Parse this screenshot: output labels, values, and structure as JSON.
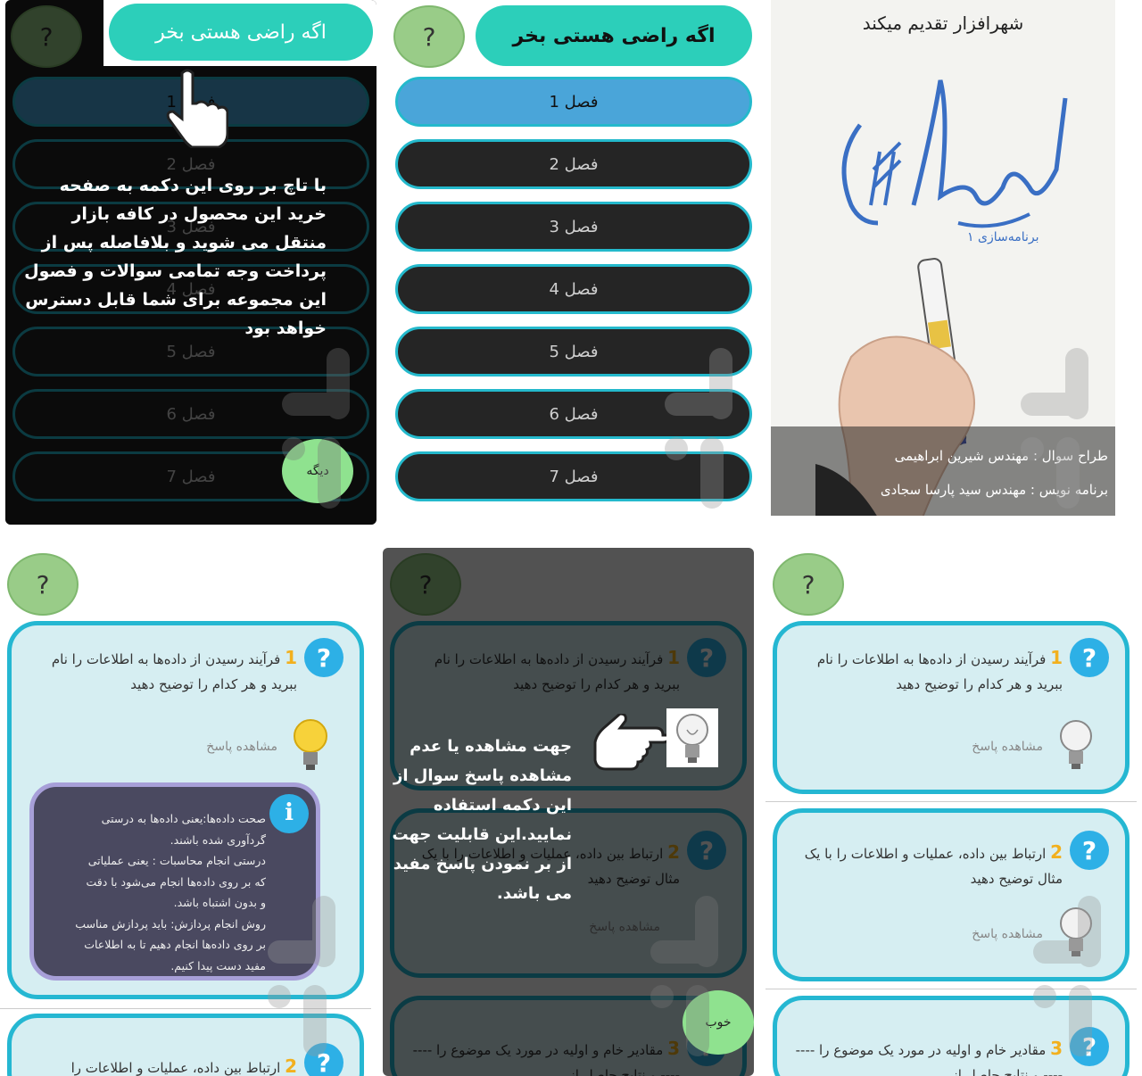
{
  "common": {
    "help_symbol": "?",
    "buy_label": "اگه راضی هستی بخر",
    "chapters": [
      "فصل 1",
      "فصل 2",
      "فصل 3",
      "فصل 4",
      "فصل 5",
      "فصل 6",
      "فصل 7"
    ],
    "see_answer": "مشاهده پاسخ"
  },
  "tutorial_buy": {
    "text": "با تاچ بر روی این دکمه به صفحه خرید این محصول در کافه بازار منتقل می شوید و بلافاصله پس از پرداخت وجه تمامی سوالات و فصول این مجموعه برای شما قابل دسترس خواهد بود",
    "next_label": "دیگه"
  },
  "splash": {
    "presents": "شهرافزار تقدیم میکند",
    "logo_text": "برنامه‌سازی ۱",
    "designer": "طراح سوال : مهندس شیرین ابراهیمی",
    "programmer": "برنامه نویس : مهندس سید پارسا سجادی"
  },
  "questions": [
    {
      "num": "1",
      "text": "فرآیند رسیدن از داده‌ها به اطلاعات را نام ببرید و هر کدام را توضیح دهید"
    },
    {
      "num": "2",
      "text": "ارتباط بین داده، عملیات و اطلاعات را با یک مثال توضیح دهید"
    },
    {
      "num": "3",
      "text": "مقادیر خام و اولیه در مورد یک موضوع را -------- و نتایج حاصل از"
    }
  ],
  "question_peek_panel4": "ارتباط بین داده، عملیات و اطلاعات را",
  "answer": {
    "info_symbol": "i",
    "lines": [
      "صحت داده‌ها:یعنی داده‌ها به درستی",
      "گردآوری شده باشند.",
      "درستی انجام محاسبات : یعنی عملیاتی",
      "که بر روی داده‌ها انجام می‌شود با دقت",
      "و بدون اشتباه باشد.",
      "روش انجام پردازش: باید پردازش مناسب",
      "بر روی داده‌ها انجام دهیم تا به اطلاعات",
      "مفید دست پیدا کنیم."
    ]
  },
  "tutorial_bulb": {
    "text": "جهت مشاهده یا عدم مشاهده پاسخ سوال از این دکمه استفاده نمایید.این قابلیت جهت از بر نمودن پاسخ مفید می باشد.",
    "next_label": "خوب"
  },
  "colors": {
    "accent_teal": "#2ccfba",
    "card_border": "#25b7d2",
    "active_chapter": "#4aa5d9",
    "help_green": "#99cc88",
    "question_number": "#f2b01e"
  }
}
